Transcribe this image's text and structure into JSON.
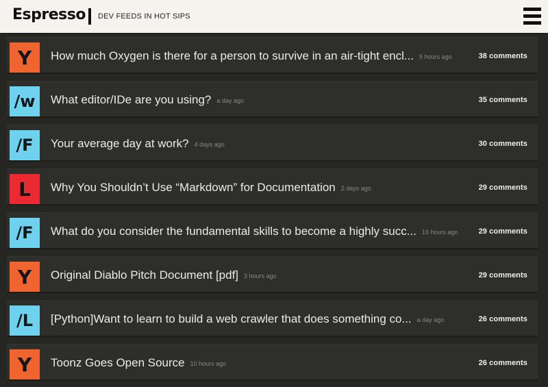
{
  "header": {
    "brand": "Espresso",
    "tagline": "DEV FEEDS IN HOT SIPS"
  },
  "colors": {
    "hacker_news": "#f0652f",
    "reddit": "#6ed2ee",
    "lobsters": "#ec2a31"
  },
  "items": [
    {
      "badge": "Y",
      "source_color": "#f0652f",
      "title": "How much Oxygen is there for a person to survive in an air-tight encl...",
      "age": "5 hours ago",
      "comments": "38 comments"
    },
    {
      "badge": "/w",
      "source_color": "#6ed2ee",
      "title": "What editor/IDe are you using?",
      "age": "a day ago",
      "comments": "35 comments"
    },
    {
      "badge": "/F",
      "source_color": "#6ed2ee",
      "title": "Your average day at work?",
      "age": "4 days ago",
      "comments": "30 comments"
    },
    {
      "badge": "L",
      "source_color": "#ec2a31",
      "title": "Why You Shouldn’t Use “Markdown” for Documentation",
      "age": "2 days ago",
      "comments": "29 comments"
    },
    {
      "badge": "/F",
      "source_color": "#6ed2ee",
      "title": "What do you consider the fundamental skills to become a highly succ...",
      "age": "19 hours ago",
      "comments": "29 comments"
    },
    {
      "badge": "Y",
      "source_color": "#f0652f",
      "title": "Original Diablo Pitch Document [pdf]",
      "age": "3 hours ago",
      "comments": "29 comments"
    },
    {
      "badge": "/L",
      "source_color": "#6ed2ee",
      "title": "[Python]Want to learn to build a web crawler that does something co...",
      "age": "a day ago",
      "comments": "26 comments"
    },
    {
      "badge": "Y",
      "source_color": "#f0652f",
      "title": "Toonz Goes Open Source",
      "age": "10 hours ago",
      "comments": "26 comments"
    }
  ]
}
